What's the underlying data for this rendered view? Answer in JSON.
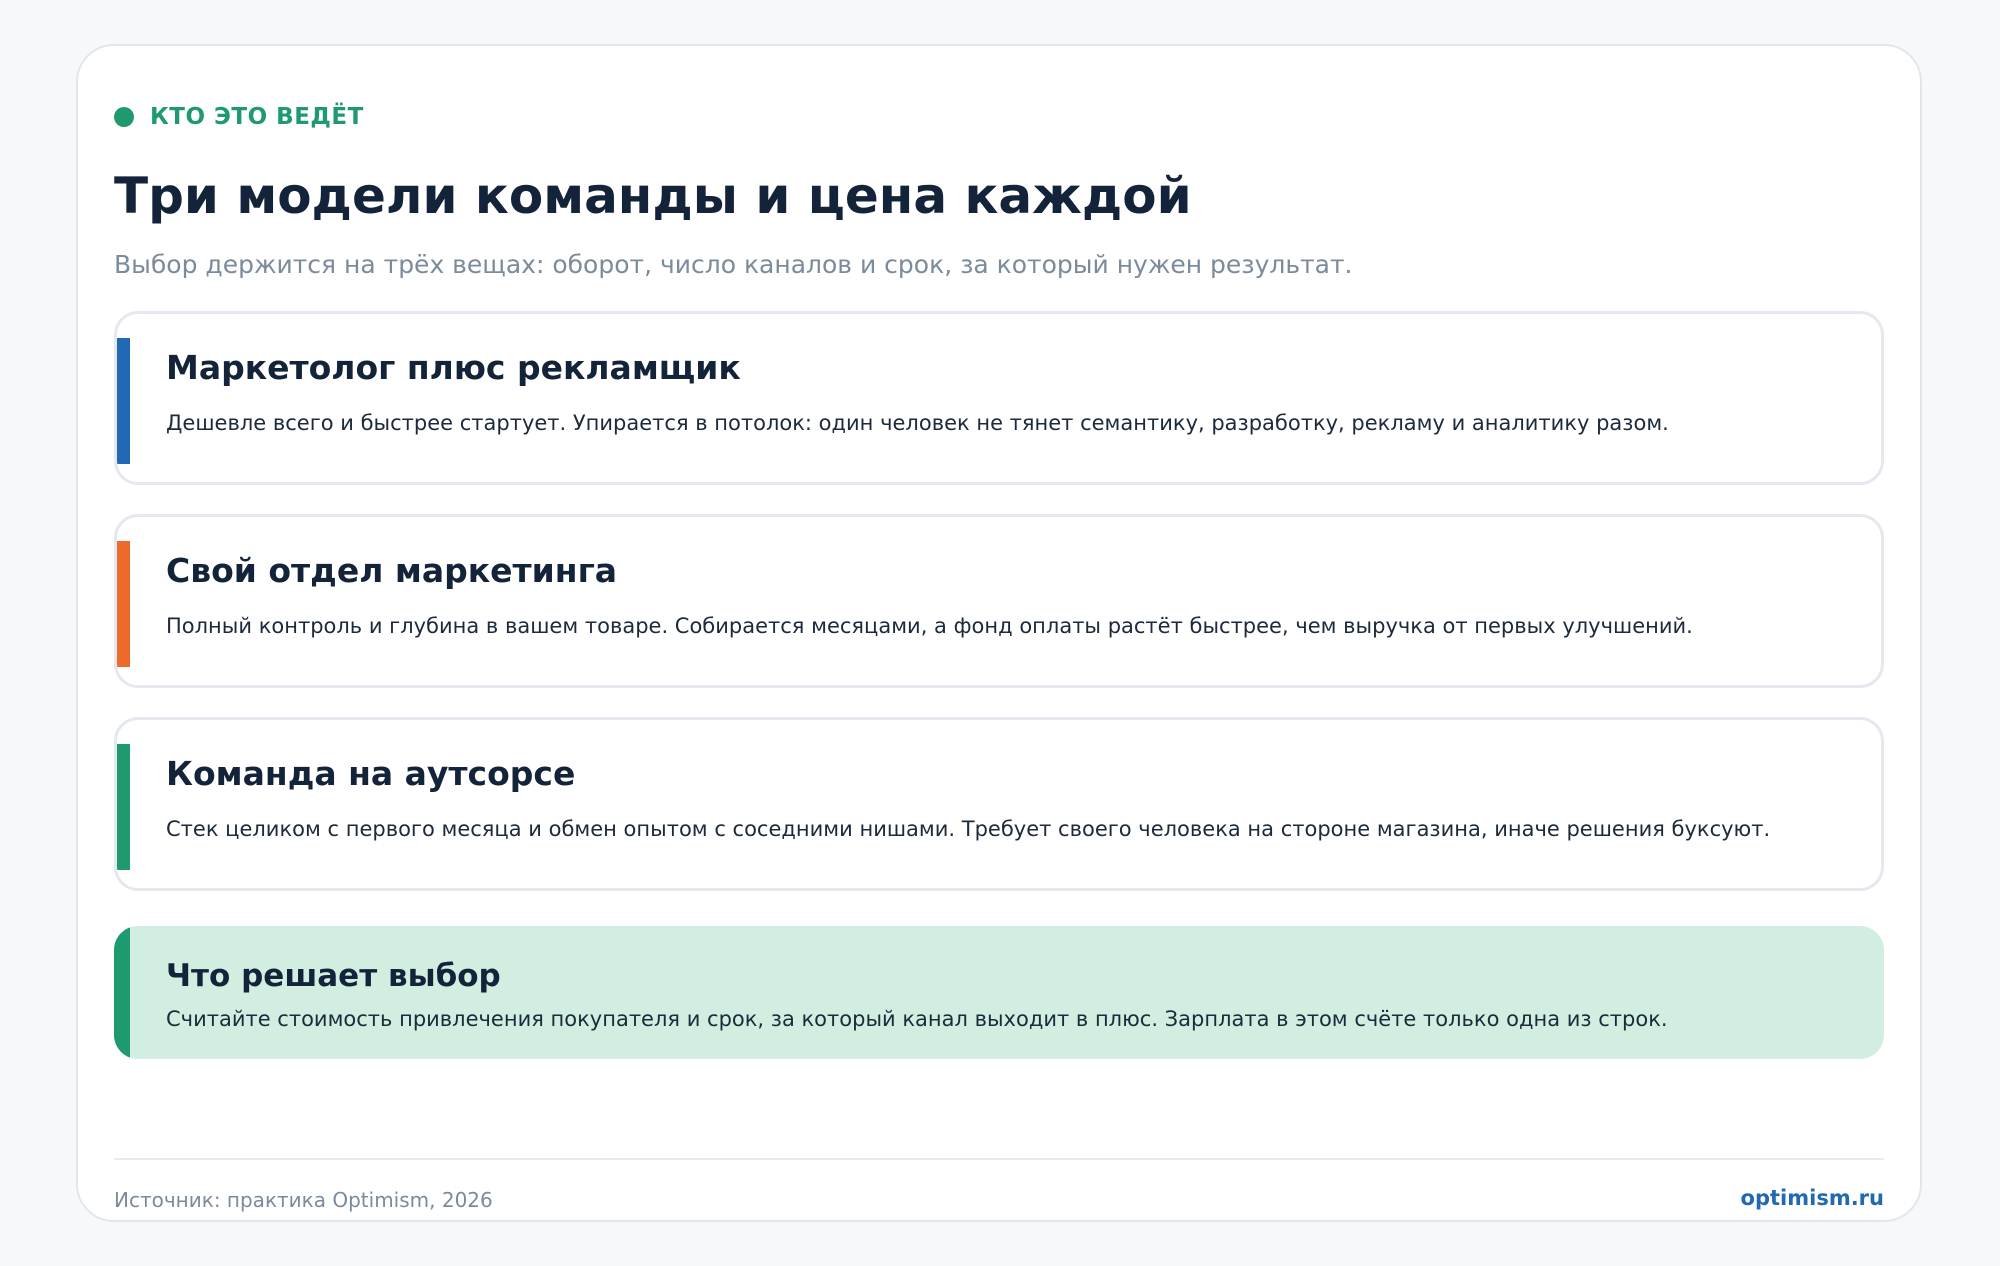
{
  "header": {
    "eyebrow": "КТО ЭТО ВЕДЁТ",
    "title": "Три модели команды и цена каждой",
    "subtitle": "Выбор держится на трёх вещах: оборот, число каналов и срок, за который нужен результат."
  },
  "options": [
    {
      "title": "Маркетолог плюс рекламщик",
      "text": "Дешевле всего и быстрее стартует. Упирается в потолок: один человек не тянет семантику, разработку, рекламу и аналитику разом.",
      "accent_color": "#2169b3"
    },
    {
      "title": "Свой отдел маркетинга",
      "text": "Полный контроль и глубина в вашем товаре. Собирается месяцами, а фонд оплаты растёт быстрее, чем выручка от первых улучшений.",
      "accent_color": "#ec6a2c"
    },
    {
      "title": "Команда на аутсорсе",
      "text": "Стек целиком с первого месяца и обмен опытом с соседними нишами. Требует своего человека на стороне магазина, иначе решения буксуют.",
      "accent_color": "#1f9a6f"
    }
  ],
  "summary": {
    "title": "Что решает выбор",
    "text": "Считайте стоимость привлечения покупателя и срок, за который канал выходит в плюс. Зарплата в этом счёте только одна из строк.",
    "background_color": "#d2eee1",
    "accent_color": "#1f9a6f"
  },
  "footer": {
    "source": "Источник: практика Optimism, 2026",
    "brand": "optimism.ru"
  },
  "colors": {
    "eyebrow": "#1f9a6f",
    "brand": "#2169b3"
  }
}
